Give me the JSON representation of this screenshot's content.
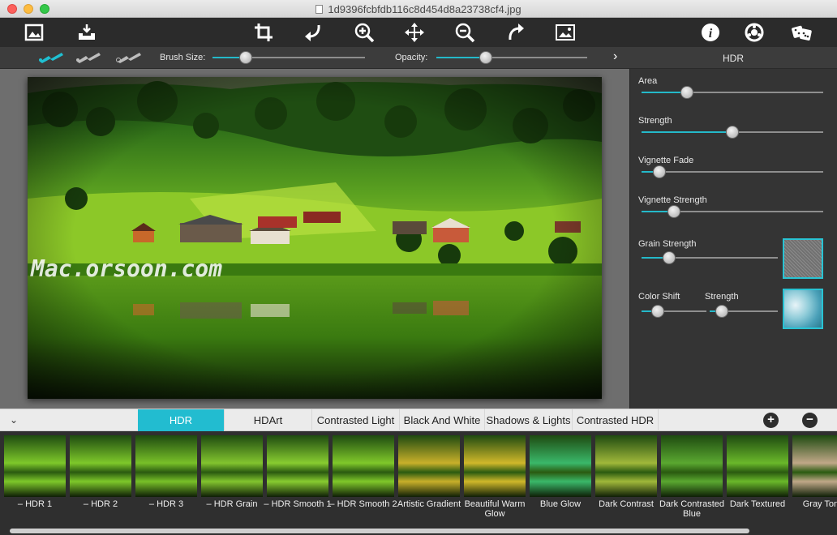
{
  "window": {
    "title": "1d9396fcbfdb116c8d454d8a23738cf4.jpg"
  },
  "toolbar": {
    "icons": [
      "image-open-icon",
      "save-tray-icon",
      "crop-icon",
      "undo-icon",
      "zoom-in-icon",
      "move-icon",
      "zoom-out-icon",
      "redo-icon",
      "compare-icon",
      "info-icon",
      "settings-icon",
      "dice-icon"
    ]
  },
  "brushbar": {
    "brush_size_label": "Brush Size:",
    "brush_size_value": 0.22,
    "opacity_label": "Opacity:",
    "opacity_value": 0.33,
    "next_glyph": "›",
    "panel_title": "HDR"
  },
  "photo": {
    "watermark": "Mac.orsoon.com"
  },
  "panel": {
    "area": {
      "label": "Area",
      "value": 0.25
    },
    "strength": {
      "label": "Strength",
      "value": 0.5
    },
    "vignette_fade": {
      "label": "Vignette Fade",
      "value": 0.1
    },
    "vignette_strength": {
      "label": "Vignette Strength",
      "value": 0.18
    },
    "grain_strength": {
      "label": "Grain Strength",
      "value": 0.2
    },
    "color_shift": {
      "label": "Color Shift",
      "value": 0.25
    },
    "strength2": {
      "label": "Strength",
      "value": 0.18
    }
  },
  "tabs": [
    "HDR",
    "HDArt",
    "Contrasted Light",
    "Black And White",
    "Shadows & Lights",
    "Contrasted HDR"
  ],
  "active_tab": 0,
  "tabbar": {
    "collapse_glyph": "⌄",
    "add_glyph": "+",
    "remove_glyph": "−"
  },
  "presets": [
    "– HDR 1",
    "– HDR 2",
    "– HDR 3",
    "– HDR Grain",
    "– HDR Smooth 1",
    "– HDR Smooth 2",
    "Artistic Gradient",
    "Beautiful Warm Glow",
    "Blue Glow",
    "Dark Contrast",
    "Dark Contrasted Blue",
    "Dark Textured",
    "Gray Tone"
  ],
  "colors": {
    "accent": "#22bcd0",
    "toolbar": "#2b2b2b",
    "panel": "#343434"
  }
}
